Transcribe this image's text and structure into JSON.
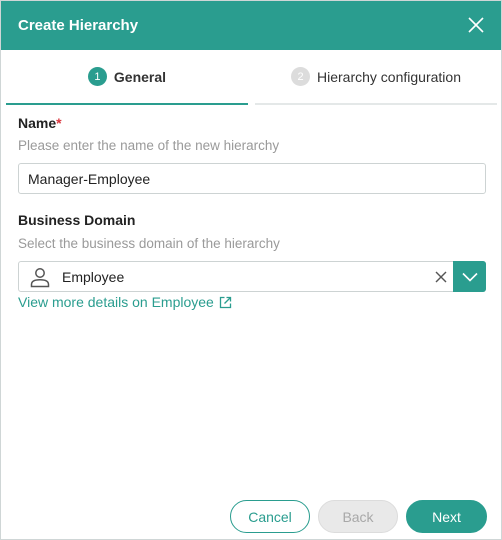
{
  "dialog": {
    "title": "Create Hierarchy"
  },
  "tabs": [
    {
      "number": "1",
      "label": "General",
      "active": true
    },
    {
      "number": "2",
      "label": "Hierarchy configuration",
      "active": false
    }
  ],
  "form": {
    "name": {
      "label": "Name",
      "required_marker": "*",
      "hint": "Please enter the name of the new hierarchy",
      "value": "Manager-Employee"
    },
    "business_domain": {
      "label": "Business Domain",
      "hint": "Select the business domain of the hierarchy",
      "value": "Employee",
      "icon": "person-icon",
      "details_link": "View more details on Employee"
    }
  },
  "footer": {
    "cancel_label": "Cancel",
    "back_label": "Back",
    "next_label": "Next"
  },
  "colors": {
    "accent": "#2a9d8f",
    "required": "#d9363e",
    "hint": "#9a9a9a"
  }
}
